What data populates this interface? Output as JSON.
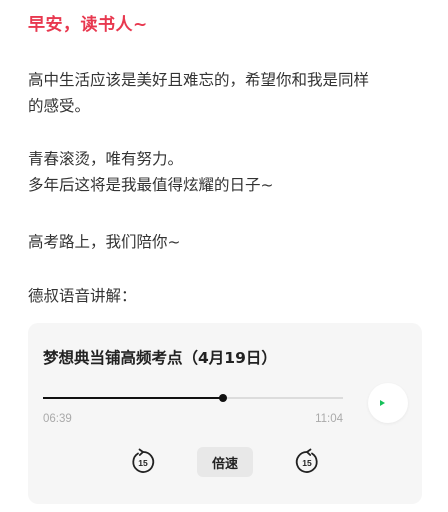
{
  "greeting": "早安，读书人~",
  "paragraphs": {
    "p1_line1": "高中生活应该是美好且难忘的，希望你和我是同样",
    "p1_line2": "的感受。",
    "p2_line1": "青春滚烫，唯有努力。",
    "p2_line2": "多年后这将是我最值得炫耀的日子~",
    "p3": "高考路上，我们陪你~",
    "p4": "德叔语音讲解："
  },
  "player": {
    "title": "梦想典当铺高频考点（4月19日）",
    "current_time": "06:39",
    "total_time": "11:04",
    "progress": 0.601,
    "speed_label": "倍速",
    "rewind_seconds": "15",
    "forward_seconds": "15",
    "accent_color": "#16c05a"
  },
  "colors": {
    "greeting": "#e8384f",
    "card_bg": "#f6f6f6"
  }
}
